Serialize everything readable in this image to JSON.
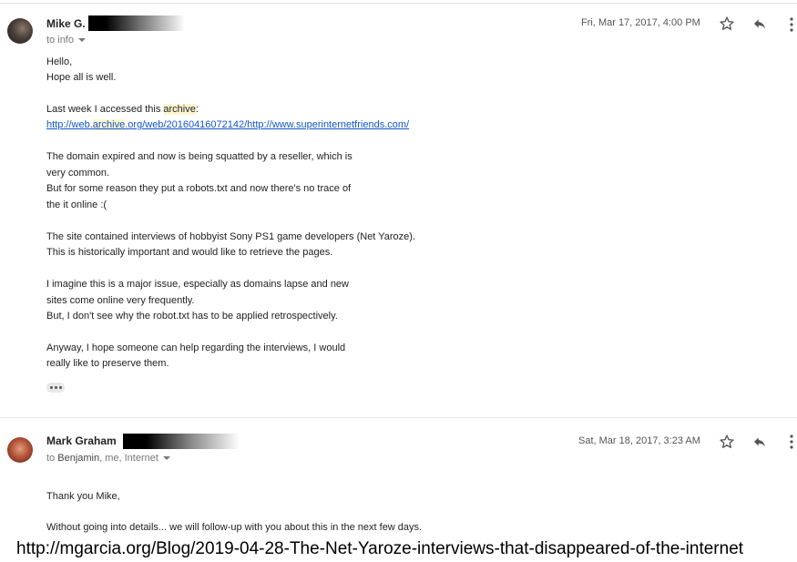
{
  "messages": [
    {
      "sender": "Mike G.",
      "recipients_prefix": "to",
      "recipients": "info",
      "date": "Fri, Mar 17, 2017, 4:00 PM",
      "body": {
        "l1": "Hello,",
        "l2": "Hope all is well.",
        "l3a": "Last week I accessed this ",
        "l3b": "archive",
        "l3c": ":",
        "link_a": "http://web.",
        "link_b": "archive",
        "link_c": ".org/web/20160416072142/http://www.superinternetfriends.com/",
        "l4": "The domain expired and now is being squatted by a reseller, which is",
        "l5": "very common.",
        "l6": "But for some reason they put a robots.txt and now there's no trace of",
        "l7": "the it online :(",
        "l8": "The site contained interviews of hobbyist Sony PS1 game developers (Net Yaroze).",
        "l9": "This is historically important and would like to retrieve the pages.",
        "l10": "I imagine this is a major issue, especially as domains lapse and new",
        "l11": "sites come online very frequently.",
        "l12": "But, I don't see why the robot.txt has to be applied retrospectively.",
        "l13": "Anyway, I hope someone can help regarding the interviews, I would",
        "l14": "really like to preserve them."
      }
    },
    {
      "sender": "Mark Graham",
      "recipients_prefix": "to",
      "recipients_first": "Benjamin",
      "recipients_rest": ", me, Internet",
      "date": "Sat, Mar 18, 2017, 3:23 AM",
      "body": {
        "l1": "Thank you Mike,",
        "l2": "Without going into details... we will follow-up with you about this in the next few days."
      }
    }
  ],
  "caption": "http://mgarcia.org/Blog/2019-04-28-The-Net-Yaroze-interviews-that-disappeared-of-the-internet",
  "icons": {
    "star": "star-outline-icon",
    "reply": "reply-icon",
    "more": "more-vert-icon"
  },
  "colors": {
    "link": "#1155cc",
    "highlight": "#fcf6cf",
    "text": "#222222",
    "meta": "#777777"
  }
}
